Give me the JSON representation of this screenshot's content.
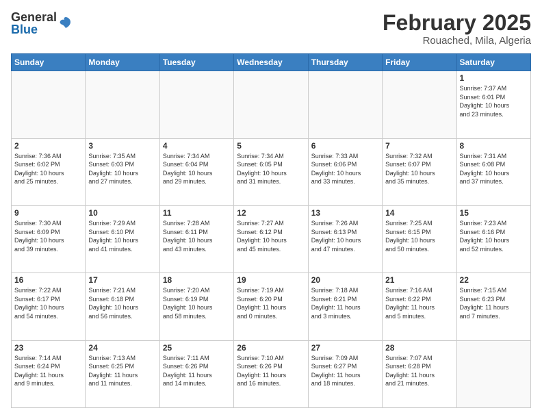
{
  "header": {
    "logo_general": "General",
    "logo_blue": "Blue",
    "month_title": "February 2025",
    "location": "Rouached, Mila, Algeria"
  },
  "weekdays": [
    "Sunday",
    "Monday",
    "Tuesday",
    "Wednesday",
    "Thursday",
    "Friday",
    "Saturday"
  ],
  "weeks": [
    [
      {
        "day": "",
        "info": ""
      },
      {
        "day": "",
        "info": ""
      },
      {
        "day": "",
        "info": ""
      },
      {
        "day": "",
        "info": ""
      },
      {
        "day": "",
        "info": ""
      },
      {
        "day": "",
        "info": ""
      },
      {
        "day": "1",
        "info": "Sunrise: 7:37 AM\nSunset: 6:01 PM\nDaylight: 10 hours\nand 23 minutes."
      }
    ],
    [
      {
        "day": "2",
        "info": "Sunrise: 7:36 AM\nSunset: 6:02 PM\nDaylight: 10 hours\nand 25 minutes."
      },
      {
        "day": "3",
        "info": "Sunrise: 7:35 AM\nSunset: 6:03 PM\nDaylight: 10 hours\nand 27 minutes."
      },
      {
        "day": "4",
        "info": "Sunrise: 7:34 AM\nSunset: 6:04 PM\nDaylight: 10 hours\nand 29 minutes."
      },
      {
        "day": "5",
        "info": "Sunrise: 7:34 AM\nSunset: 6:05 PM\nDaylight: 10 hours\nand 31 minutes."
      },
      {
        "day": "6",
        "info": "Sunrise: 7:33 AM\nSunset: 6:06 PM\nDaylight: 10 hours\nand 33 minutes."
      },
      {
        "day": "7",
        "info": "Sunrise: 7:32 AM\nSunset: 6:07 PM\nDaylight: 10 hours\nand 35 minutes."
      },
      {
        "day": "8",
        "info": "Sunrise: 7:31 AM\nSunset: 6:08 PM\nDaylight: 10 hours\nand 37 minutes."
      }
    ],
    [
      {
        "day": "9",
        "info": "Sunrise: 7:30 AM\nSunset: 6:09 PM\nDaylight: 10 hours\nand 39 minutes."
      },
      {
        "day": "10",
        "info": "Sunrise: 7:29 AM\nSunset: 6:10 PM\nDaylight: 10 hours\nand 41 minutes."
      },
      {
        "day": "11",
        "info": "Sunrise: 7:28 AM\nSunset: 6:11 PM\nDaylight: 10 hours\nand 43 minutes."
      },
      {
        "day": "12",
        "info": "Sunrise: 7:27 AM\nSunset: 6:12 PM\nDaylight: 10 hours\nand 45 minutes."
      },
      {
        "day": "13",
        "info": "Sunrise: 7:26 AM\nSunset: 6:13 PM\nDaylight: 10 hours\nand 47 minutes."
      },
      {
        "day": "14",
        "info": "Sunrise: 7:25 AM\nSunset: 6:15 PM\nDaylight: 10 hours\nand 50 minutes."
      },
      {
        "day": "15",
        "info": "Sunrise: 7:23 AM\nSunset: 6:16 PM\nDaylight: 10 hours\nand 52 minutes."
      }
    ],
    [
      {
        "day": "16",
        "info": "Sunrise: 7:22 AM\nSunset: 6:17 PM\nDaylight: 10 hours\nand 54 minutes."
      },
      {
        "day": "17",
        "info": "Sunrise: 7:21 AM\nSunset: 6:18 PM\nDaylight: 10 hours\nand 56 minutes."
      },
      {
        "day": "18",
        "info": "Sunrise: 7:20 AM\nSunset: 6:19 PM\nDaylight: 10 hours\nand 58 minutes."
      },
      {
        "day": "19",
        "info": "Sunrise: 7:19 AM\nSunset: 6:20 PM\nDaylight: 11 hours\nand 0 minutes."
      },
      {
        "day": "20",
        "info": "Sunrise: 7:18 AM\nSunset: 6:21 PM\nDaylight: 11 hours\nand 3 minutes."
      },
      {
        "day": "21",
        "info": "Sunrise: 7:16 AM\nSunset: 6:22 PM\nDaylight: 11 hours\nand 5 minutes."
      },
      {
        "day": "22",
        "info": "Sunrise: 7:15 AM\nSunset: 6:23 PM\nDaylight: 11 hours\nand 7 minutes."
      }
    ],
    [
      {
        "day": "23",
        "info": "Sunrise: 7:14 AM\nSunset: 6:24 PM\nDaylight: 11 hours\nand 9 minutes."
      },
      {
        "day": "24",
        "info": "Sunrise: 7:13 AM\nSunset: 6:25 PM\nDaylight: 11 hours\nand 11 minutes."
      },
      {
        "day": "25",
        "info": "Sunrise: 7:11 AM\nSunset: 6:26 PM\nDaylight: 11 hours\nand 14 minutes."
      },
      {
        "day": "26",
        "info": "Sunrise: 7:10 AM\nSunset: 6:26 PM\nDaylight: 11 hours\nand 16 minutes."
      },
      {
        "day": "27",
        "info": "Sunrise: 7:09 AM\nSunset: 6:27 PM\nDaylight: 11 hours\nand 18 minutes."
      },
      {
        "day": "28",
        "info": "Sunrise: 7:07 AM\nSunset: 6:28 PM\nDaylight: 11 hours\nand 21 minutes."
      },
      {
        "day": "",
        "info": ""
      }
    ]
  ]
}
